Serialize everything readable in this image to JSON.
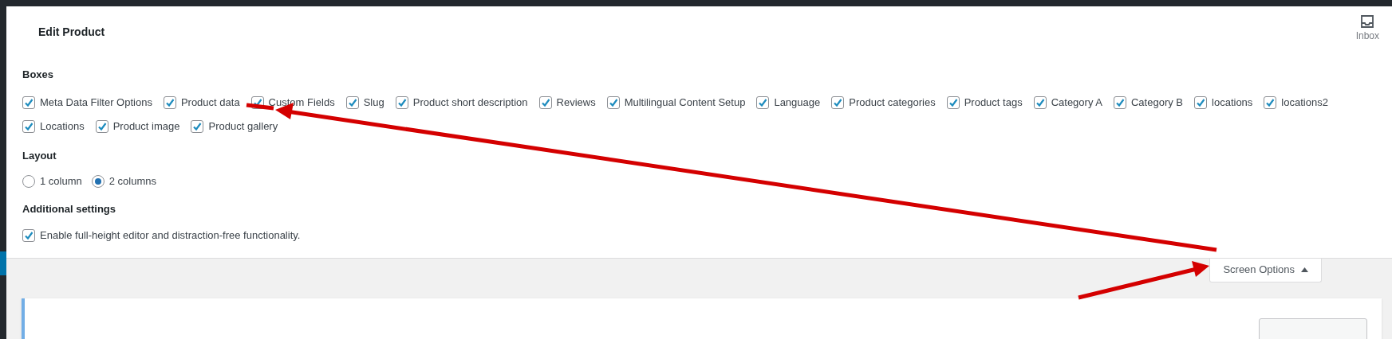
{
  "header": {
    "title": "Edit Product",
    "inbox_label": "Inbox"
  },
  "boxes": {
    "heading": "Boxes",
    "items": [
      {
        "label": "Meta Data Filter Options",
        "checked": true
      },
      {
        "label": "Product data",
        "checked": true
      },
      {
        "label": "Custom Fields",
        "checked": true
      },
      {
        "label": "Slug",
        "checked": true
      },
      {
        "label": "Product short description",
        "checked": true
      },
      {
        "label": "Reviews",
        "checked": true
      },
      {
        "label": "Multilingual Content Setup",
        "checked": true
      },
      {
        "label": "Language",
        "checked": true
      },
      {
        "label": "Product categories",
        "checked": true
      },
      {
        "label": "Product tags",
        "checked": true
      },
      {
        "label": "Category A",
        "checked": true
      },
      {
        "label": "Category B",
        "checked": true
      },
      {
        "label": "locations",
        "checked": true
      },
      {
        "label": "locations2",
        "checked": true
      },
      {
        "label": "Locations",
        "checked": true
      },
      {
        "label": "Product image",
        "checked": true
      },
      {
        "label": "Product gallery",
        "checked": true
      }
    ]
  },
  "layout": {
    "heading": "Layout",
    "options": [
      {
        "label": "1 column",
        "selected": false
      },
      {
        "label": "2 columns",
        "selected": true
      }
    ]
  },
  "additional": {
    "heading": "Additional settings",
    "items": [
      {
        "label": "Enable full-height editor and distraction-free functionality.",
        "checked": true
      }
    ]
  },
  "screen_options": {
    "label": "Screen Options",
    "expanded": true
  }
}
